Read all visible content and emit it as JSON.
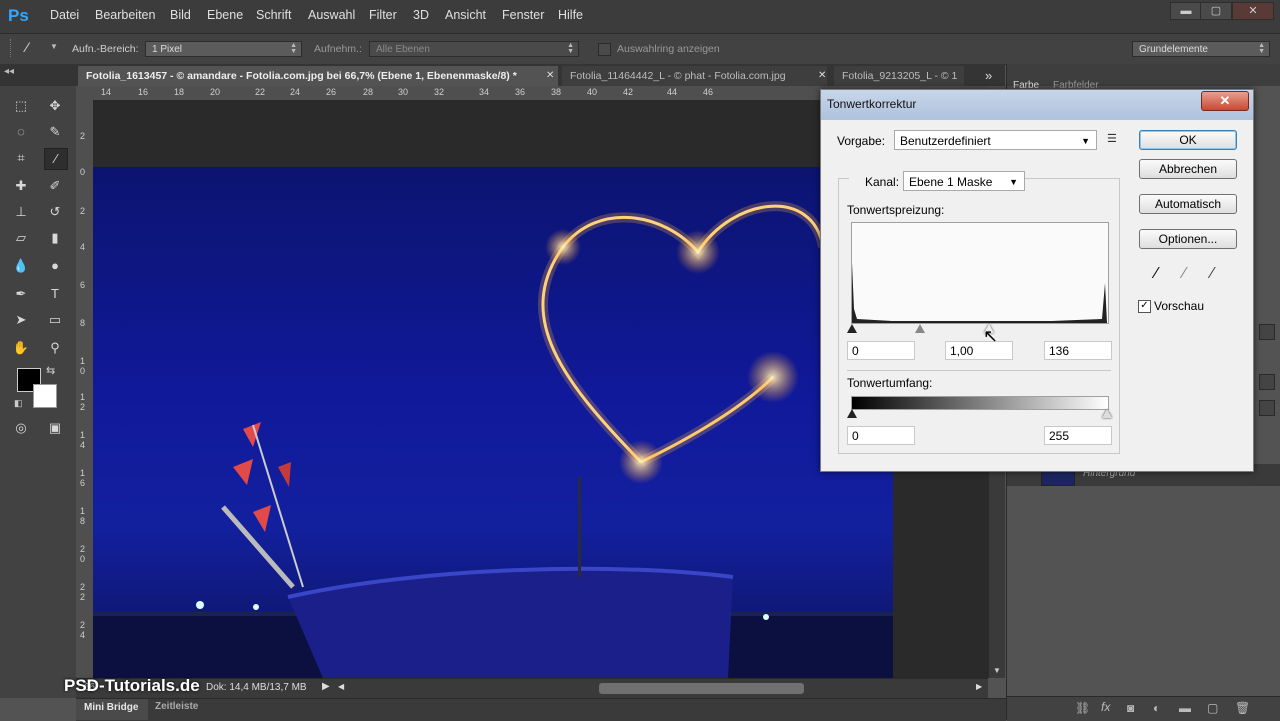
{
  "app": {
    "logo": "Ps"
  },
  "menu": [
    "Datei",
    "Bearbeiten",
    "Bild",
    "Ebene",
    "Schrift",
    "Auswahl",
    "Filter",
    "3D",
    "Ansicht",
    "Fenster",
    "Hilfe"
  ],
  "window_controls": {
    "minimize": "▬",
    "maximize": "▢",
    "close": "✕"
  },
  "options_bar": {
    "sample_label": "Aufn.-Bereich:",
    "sample_value": "1 Pixel",
    "sample_from_label": "Aufnehm.:",
    "sample_from_value": "Alle Ebenen",
    "show_ring_label": "Auswahlring anzeigen",
    "workspace": "Grundelemente"
  },
  "tabs": [
    {
      "label": "Fotolia_1613457 - © amandare - Fotolia.com.jpg bei 66,7% (Ebene 1, Ebenenmaske/8) *",
      "close": "✕"
    },
    {
      "label": "Fotolia_11464442_L - © phat - Fotolia.com.jpg",
      "close": "✕"
    },
    {
      "label": "Fotolia_9213205_L - © 1",
      "close": ""
    }
  ],
  "tab_overflow": "»",
  "ruler_top": [
    "14",
    "16",
    "18",
    "20",
    "22",
    "24",
    "26",
    "28",
    "30",
    "32",
    "34",
    "36",
    "38",
    "40",
    "42",
    "44",
    "46"
  ],
  "ruler_left": [
    "2",
    "0",
    "2",
    "4",
    "6",
    "8",
    "1",
    "0",
    "1",
    "2",
    "1",
    "4",
    "1",
    "6",
    "1",
    "8",
    "2",
    "0",
    "2",
    "2",
    "2",
    "4"
  ],
  "status": {
    "zoom": "66",
    "doc": "Dok: 14,4 MB/13,7 MB"
  },
  "bottom_tabs": [
    "Mini Bridge",
    "Zeitleiste"
  ],
  "panel": {
    "tab1": "Farbe",
    "tab2": "Farbfelder",
    "layer_name": "Hintergrund"
  },
  "watermark": "PSD-Tutorials.de",
  "dialog": {
    "title": "Tonwertkorrektur",
    "close": "✕",
    "preset_label": "Vorgabe:",
    "preset_value": "Benutzerdefiniert",
    "channel_label": "Kanal:",
    "channel_value": "Ebene 1 Maske",
    "input_levels_label": "Tonwertspreizung:",
    "input_black": "0",
    "input_gamma": "1,00",
    "input_white": "136",
    "output_levels_label": "Tonwertumfang:",
    "output_black": "0",
    "output_white": "255",
    "buttons": {
      "ok": "OK",
      "cancel": "Abbrechen",
      "auto": "Automatisch",
      "options": "Optionen..."
    },
    "preview_label": "Vorschau",
    "preview_checked": true
  },
  "colors": {
    "accent": "#31a8ff",
    "ui_dark": "#424242",
    "dialog_bg": "#f0f0f0"
  }
}
